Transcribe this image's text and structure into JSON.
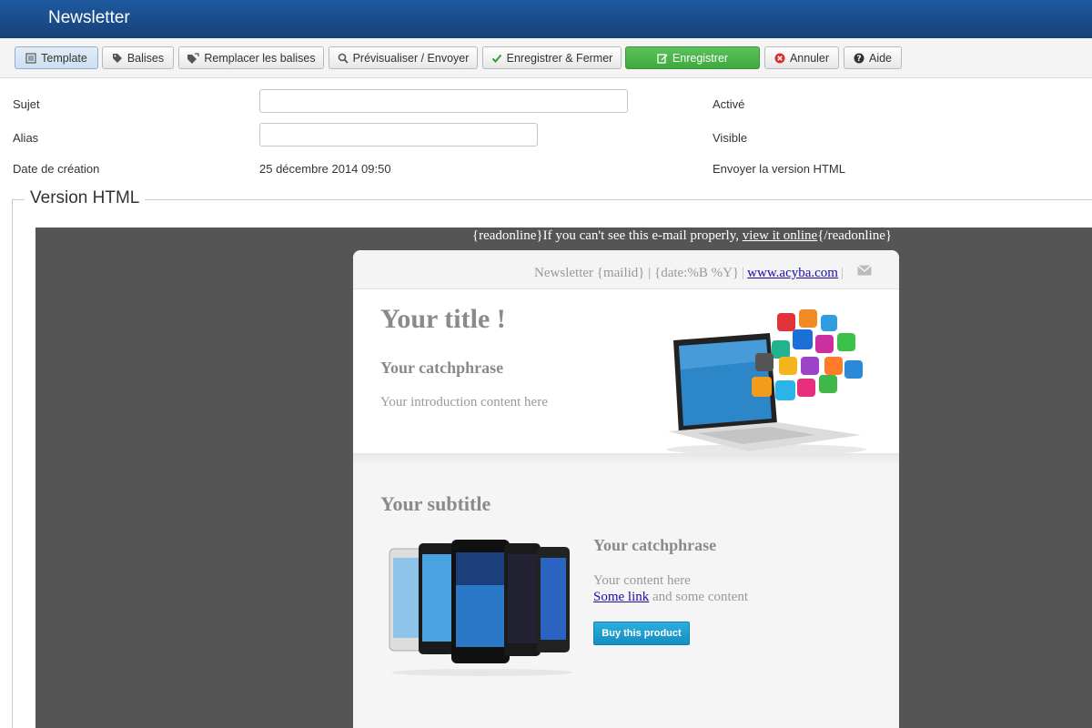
{
  "window": {
    "title": "Newsletter"
  },
  "toolbar": {
    "buttons": [
      {
        "label": "Template",
        "icon": "template-icon"
      },
      {
        "label": "Balises",
        "icon": "tag-icon"
      },
      {
        "label": "Remplacer les balises",
        "icon": "tag-replace-icon"
      },
      {
        "label": "Prévisualiser / Envoyer",
        "icon": "search-icon"
      },
      {
        "label": "Enregistrer & Fermer",
        "icon": "check-icon"
      },
      {
        "label": "Enregistrer",
        "icon": "edit-icon"
      },
      {
        "label": "Annuler",
        "icon": "cancel-icon"
      },
      {
        "label": "Aide",
        "icon": "help-icon"
      }
    ]
  },
  "form": {
    "subject_label": "Sujet",
    "subject_value": "",
    "alias_label": "Alias",
    "alias_value": "",
    "date_label": "Date de création",
    "date_value": "25 décembre 2014 09:50",
    "active_label": "Activé",
    "visible_label": "Visible",
    "html_label": "Envoyer la version HTML"
  },
  "section": {
    "legend": "Version HTML"
  },
  "email": {
    "readonline_prefix": "{readonline}If you can't see this e-mail properly, ",
    "readonline_link": "view it online",
    "readonline_suffix": "{/readonline}",
    "header_text": "Newsletter {mailid} | {date:%B %Y}",
    "header_link": "www.acyba.com",
    "hero_title": "Your title !",
    "hero_catchphrase": "Your catchphrase",
    "hero_intro": "Your introduction content here",
    "subtitle": "Your subtitle",
    "sub_catchphrase": "Your catchphrase",
    "sub_content": "Your content here",
    "sub_link": "Some link",
    "sub_link_suffix": " and some content",
    "buy_button": "Buy this product"
  },
  "colors": {
    "topbar": "#1a4d8c",
    "green_button": "#4cb64c",
    "preview_background": "#555555",
    "buy_button": "#1fa0d4"
  }
}
